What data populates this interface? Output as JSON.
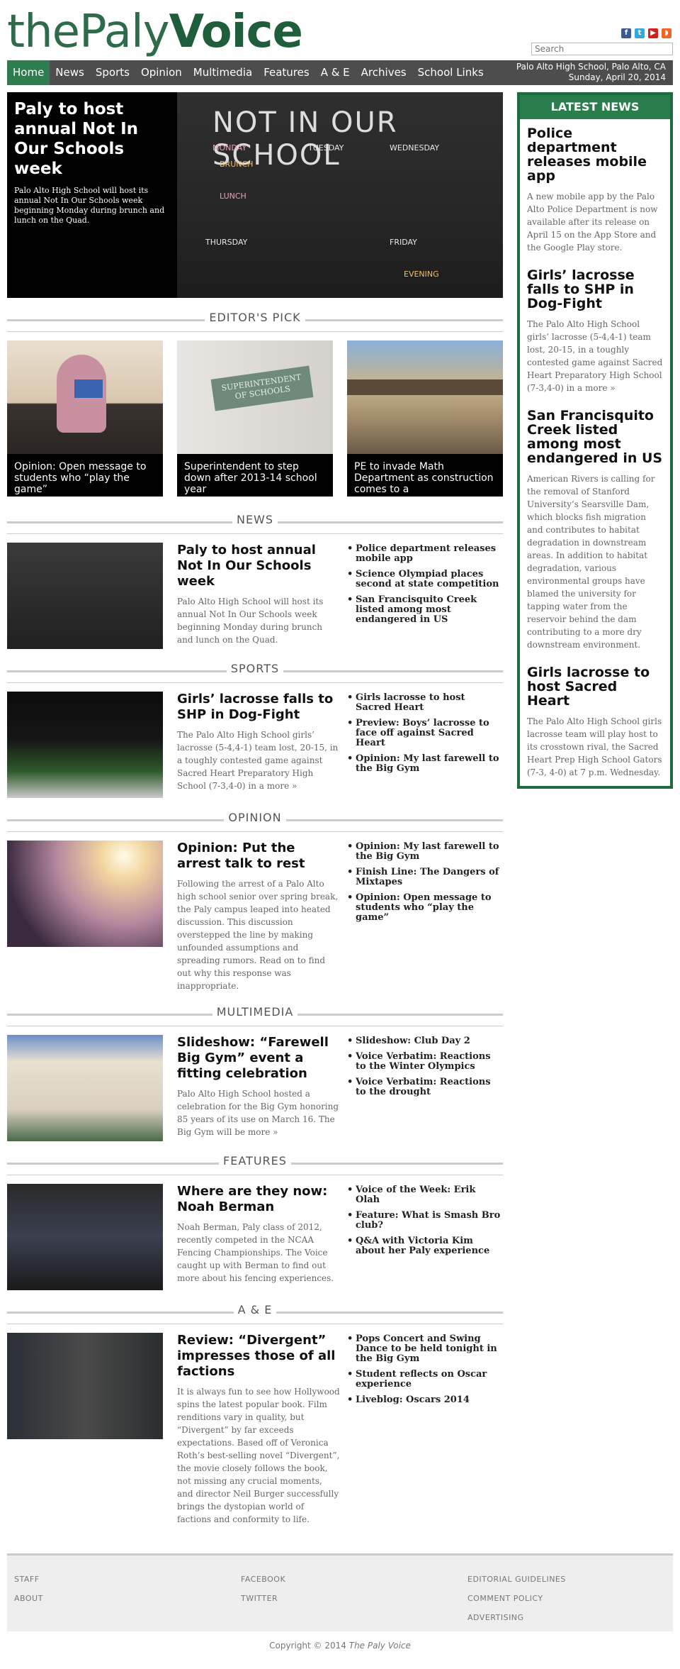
{
  "site": {
    "logo_the": "the",
    "logo_paly": "Paly",
    "logo_voice": "Voice",
    "search_placeholder": "Search",
    "location": "Palo Alto High School, Palo Alto, CA",
    "date": "Sunday, April 20, 2014"
  },
  "social": [
    {
      "name": "facebook-icon",
      "glyph": "f",
      "color": "#3b5998"
    },
    {
      "name": "twitter-icon",
      "glyph": "t",
      "color": "#33aadd"
    },
    {
      "name": "youtube-icon",
      "glyph": "▶",
      "color": "#d32121"
    },
    {
      "name": "rss-icon",
      "glyph": "◗",
      "color": "#f26522"
    }
  ],
  "nav": [
    "Home",
    "News",
    "Sports",
    "Opinion",
    "Multimedia",
    "Features",
    "A & E",
    "Archives",
    "School Links"
  ],
  "feature": {
    "title": "Paly to host annual Not In Our Schools week",
    "desc": "Palo Alto High School will host its annual Not In Our Schools week beginning Monday during brunch and lunch on the Quad.",
    "board_title": "NOT IN OUR SCHOOL",
    "chalk": [
      "MONDAY",
      "TUESDAY",
      "WEDNESDAY",
      "BRUNCH",
      "LUNCH",
      "THURSDAY",
      "FRIDAY",
      "EVENING"
    ]
  },
  "editors_pick": {
    "label": "EDITOR'S PICK",
    "items": [
      {
        "caption": "Opinion: Open message to students who “play the game”"
      },
      {
        "caption": "Superintendent to step down after 2013-14 school year"
      },
      {
        "caption": "PE to invade Math Department as construction comes to a"
      }
    ],
    "sign_text": "SUPERINTENDENT OF SCHOOLS"
  },
  "sections": [
    {
      "label": "NEWS",
      "title": "Paly to host annual Not In Our Schools week",
      "desc": "Palo Alto High School will host its annual Not In Our Schools week beginning Monday during brunch and lunch on the Quad.",
      "list": [
        "Police department releases mobile app",
        "Science Olympiad places second at state competition",
        "San Francisquito Creek listed among most endangered in US"
      ]
    },
    {
      "label": "SPORTS",
      "title": "Girls’ lacrosse falls to SHP in Dog-Fight",
      "desc": "The Palo Alto High School girls’ lacrosse (5-4,4-1) team lost, 20-15, in a toughly contested game against Sacred Heart Preparatory High School (7-3,4-0) in a more »",
      "list": [
        "Girls lacrosse to host Sacred Heart",
        "Preview: Boys’ lacrosse to face off against Sacred Heart",
        "Opinion: My last farewell to the Big Gym"
      ]
    },
    {
      "label": "OPINION",
      "title": "Opinion: Put the arrest talk to rest",
      "desc": "Following the arrest of a Palo Alto high school senior over spring break, the Paly campus leaped into heated discussion. This discussion overstepped the line by making unfounded assumptions and spreading rumors. Read on to find out why this response was inappropriate.",
      "list": [
        "Opinion: My last farewell to the Big Gym",
        "Finish Line: The Dangers of Mixtapes",
        "Opinion: Open message to students who “play the game”"
      ]
    },
    {
      "label": "MULTIMEDIA",
      "title": "Slideshow: “Farewell Big Gym” event a fitting celebration",
      "desc": "Palo Alto High School hosted a celebration for the Big Gym honoring 85 years of its use on March 16. The Big Gym will be more »",
      "list": [
        "Slideshow: Club Day 2",
        "Voice Verbatim: Reactions to the Winter Olympics",
        "Voice Verbatim: Reactions to the drought"
      ]
    },
    {
      "label": "FEATURES",
      "title": "Where are they now: Noah Berman",
      "desc": "Noah Berman, Paly class of 2012, recently competed in the NCAA Fencing Championships. The Voice caught up with Berman to find out more about his fencing experiences.",
      "list": [
        "Voice of the Week: Erik Olah",
        "Feature: What is Smash Bro club?",
        "Q&A with Victoria Kim about her Paly experience"
      ]
    },
    {
      "label": "A & E",
      "title": "Review: “Divergent” impresses those of all factions",
      "desc": "It is always fun to see how Hollywood spins the latest popular book. Film renditions vary in quality, but “Divergent” by far exceeds expectations. Based off of Veronica Roth’s best-selling novel “Divergent”, the movie closely follows the book, not missing any crucial moments, and director Neil Burger successfully brings the dystopian world of factions and conformity to life.",
      "list": [
        "Pops Concert and Swing Dance to be held tonight in the Big Gym",
        "Student reflects on Oscar experience",
        "Liveblog: Oscars 2014"
      ]
    }
  ],
  "sidebar": {
    "heading": "LATEST NEWS",
    "items": [
      {
        "title": "Police department releases mobile app",
        "desc": "A new mobile app by the Palo Alto Police Department is now available after its release on April 15 on the App Store and the Google Play store."
      },
      {
        "title": "Girls’ lacrosse falls to SHP in Dog-Fight",
        "desc": "The Palo Alto High School girls’ lacrosse (5-4,4-1) team lost, 20-15, in a toughly contested game against Sacred Heart Preparatory High School (7-3,4-0) in a more »"
      },
      {
        "title": "San Francisquito Creek listed among most endangered in US",
        "desc": "American Rivers is calling for the removal of Stanford University’s Searsville Dam, which blocks fish migration and contributes to habitat degradation in downstream areas. In addition to habitat degradation, various environmental groups have blamed the university for tapping water from the reservoir behind the dam contributing to a more dry downstream environment."
      },
      {
        "title": "Girls lacrosse to host Sacred Heart",
        "desc": "The Palo Alto High School girls lacrosse team will play host to its crosstown rival, the Sacred Heart Prep High School Gators (7-3, 4-0) at 7 p.m. Wednesday."
      }
    ]
  },
  "footer": {
    "col1": [
      "STAFF",
      "ABOUT"
    ],
    "col2": [
      "FACEBOOK",
      "TWITTER"
    ],
    "col3": [
      "EDITORIAL GUIDELINES",
      "COMMENT POLICY",
      "ADVERTISING"
    ],
    "copyright_prefix": "Copyright © 2014",
    "copyright_name": "The Paly Voice"
  }
}
